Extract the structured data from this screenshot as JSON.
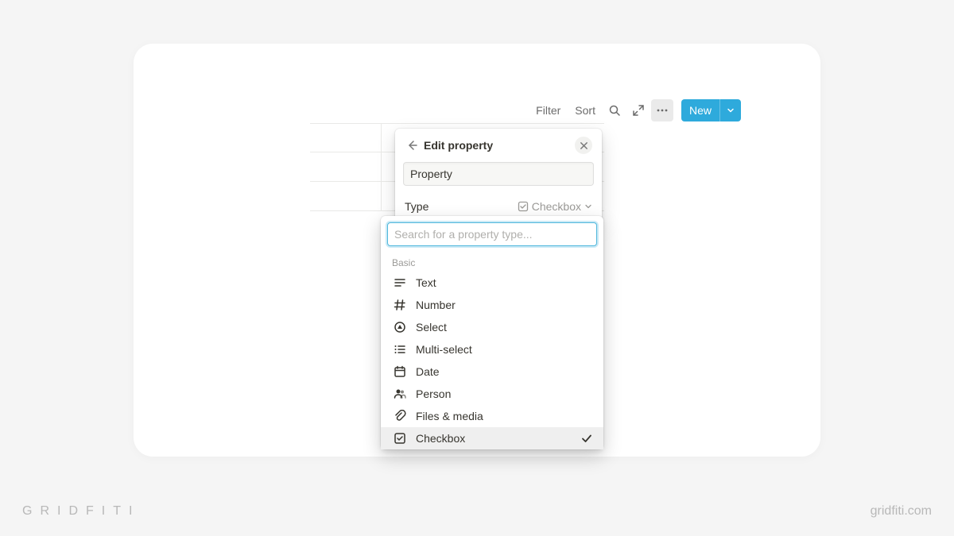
{
  "toolbar": {
    "filter_label": "Filter",
    "sort_label": "Sort",
    "new_label": "New"
  },
  "panel": {
    "title": "Edit property",
    "name_value": "Property",
    "type_label": "Type",
    "type_value": "Checkbox"
  },
  "dropdown": {
    "search_placeholder": "Search for a property type...",
    "section_label": "Basic",
    "options": [
      {
        "label": "Text",
        "icon": "text"
      },
      {
        "label": "Number",
        "icon": "number"
      },
      {
        "label": "Select",
        "icon": "select"
      },
      {
        "label": "Multi-select",
        "icon": "multiselect"
      },
      {
        "label": "Date",
        "icon": "date"
      },
      {
        "label": "Person",
        "icon": "person"
      },
      {
        "label": "Files & media",
        "icon": "files"
      },
      {
        "label": "Checkbox",
        "icon": "checkbox",
        "selected": true
      }
    ]
  },
  "branding": {
    "left": "GRIDFITI",
    "right": "gridfiti.com"
  }
}
